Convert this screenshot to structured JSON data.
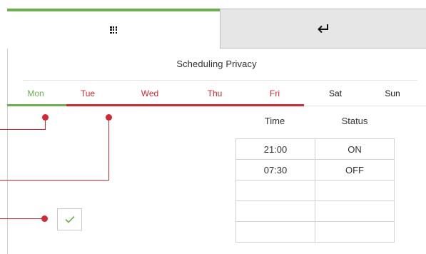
{
  "tabs": {
    "grid_icon": "grid-icon",
    "back_icon": "return-arrow-icon"
  },
  "title": "Scheduling Privacy",
  "days": [
    {
      "label": "Mon",
      "color": "#6ab04c"
    },
    {
      "label": "Tue",
      "color": "#d6262f"
    },
    {
      "label": "Wed",
      "color": "#d6262f"
    },
    {
      "label": "Thu",
      "color": "#d6262f"
    },
    {
      "label": "Fri",
      "color": "#d6262f"
    },
    {
      "label": "Sat",
      "color": "#111111"
    },
    {
      "label": "Sun",
      "color": "#111111"
    }
  ],
  "table": {
    "headers": {
      "time": "Time",
      "status": "Status"
    },
    "rows": [
      {
        "time": "21:00",
        "status": "ON"
      },
      {
        "time": "07:30",
        "status": "OFF"
      },
      {
        "time": "",
        "status": ""
      },
      {
        "time": "",
        "status": ""
      },
      {
        "time": "",
        "status": ""
      }
    ]
  },
  "confirm_icon": "checkmark-icon",
  "colors": {
    "accent_green": "#6ab04c",
    "annotation_red": "#d6262f",
    "inactive_tab": "#e6e6e6"
  }
}
